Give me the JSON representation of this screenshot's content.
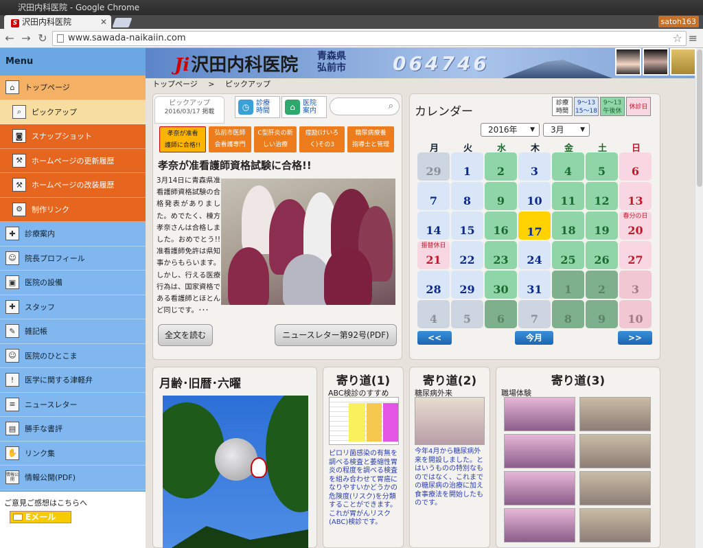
{
  "window": {
    "title": "沢田内科医院 - Google Chrome",
    "tab_title": "沢田内科医院",
    "user": "satoh163",
    "url": "www.sawada-naikaiin.com"
  },
  "banner": {
    "logo": "沢田内科医院",
    "pref1": "青森県",
    "pref2": "弘前市",
    "phone": "064746"
  },
  "sidebar": {
    "heading": "Menu",
    "items": [
      {
        "label": "トップページ",
        "icon": "house-icon"
      },
      {
        "label": "ピックアップ",
        "icon": "magnifier-icon"
      },
      {
        "label": "スナップショット",
        "icon": "camera-icon"
      },
      {
        "label": "ホームページの更新履歴",
        "icon": "hammer-icon"
      },
      {
        "label": "ホームページの改装履歴",
        "icon": "hammer-icon"
      },
      {
        "label": "制作リンク",
        "icon": "gear-icon"
      },
      {
        "label": "診療案内",
        "icon": "clinic-icon"
      },
      {
        "label": "院長プロフィール",
        "icon": "doctor-icon"
      },
      {
        "label": "医院の設備",
        "icon": "equipment-icon"
      },
      {
        "label": "スタッフ",
        "icon": "nurse-cap-icon"
      },
      {
        "label": "雑記帳",
        "icon": "notebook-icon"
      },
      {
        "label": "医院のひとこま",
        "icon": "photo-icon"
      },
      {
        "label": "医学に関する津軽弁",
        "icon": "exclamation-icon"
      },
      {
        "label": "ニュースレター",
        "icon": "newsletter-icon"
      },
      {
        "label": "勝手な書評",
        "icon": "book-icon"
      },
      {
        "label": "リンク集",
        "icon": "handshake-icon"
      },
      {
        "label": "情報公開(PDF)",
        "icon": "info-icon"
      }
    ],
    "feedback_label": "ご意見ご感想はこちらへ",
    "email_button": "Eメール",
    "info_icon_text": "情報公開"
  },
  "breadcrumb": {
    "home": "トップページ",
    "sep": ">",
    "current": "ピックアップ"
  },
  "pickup": {
    "tab_label": "ピックアップ",
    "tab_date": "2016/03/17 掲載",
    "quick1": [
      "診療",
      "時間"
    ],
    "quick2": [
      "医院",
      "案内"
    ],
    "tags": [
      [
        "孝奈が准看",
        "護師に合格!!"
      ],
      [
        "弘前市医師",
        "会看護専門"
      ],
      [
        "C型肝炎の新",
        "しい治療"
      ],
      [
        "痙励(けいろ",
        "く)その3"
      ],
      [
        "糖尿病療養",
        "指導士と管理"
      ]
    ],
    "headline": "孝奈が准看護師資格試験に合格!!",
    "body": "3月14日に青森県准看護師資格試験の合格発表がありました。めでたく、棟方孝奈さんは合格しました。おめでとう!!准看護師免許は県知事からもらいます。しかし、行える医療行為は、国家資格である看護師とほとんど同じです。･･･",
    "read_more": "全文を読む",
    "newsletter": "ニュースレター第92号(PDF)"
  },
  "calendar": {
    "title": "カレンダー",
    "legend": [
      [
        "診療",
        "時間"
      ],
      [
        "9～13",
        "15～18"
      ],
      [
        "9～13",
        "午後休"
      ],
      [
        "休診日",
        ""
      ]
    ],
    "year": "2016年",
    "month": "3月",
    "weekdays": [
      "月",
      "火",
      "水",
      "木",
      "金",
      "土",
      "日"
    ],
    "weeks": [
      [
        {
          "d": "29",
          "k": "out"
        },
        {
          "d": "1",
          "k": "n"
        },
        {
          "d": "2",
          "k": "g"
        },
        {
          "d": "3",
          "k": "n"
        },
        {
          "d": "4",
          "k": "g"
        },
        {
          "d": "5",
          "k": "g"
        },
        {
          "d": "6",
          "k": "h"
        }
      ],
      [
        {
          "d": "7",
          "k": "n"
        },
        {
          "d": "8",
          "k": "n"
        },
        {
          "d": "9",
          "k": "g"
        },
        {
          "d": "10",
          "k": "n"
        },
        {
          "d": "11",
          "k": "g"
        },
        {
          "d": "12",
          "k": "g"
        },
        {
          "d": "13",
          "k": "h"
        }
      ],
      [
        {
          "d": "14",
          "k": "n"
        },
        {
          "d": "15",
          "k": "n"
        },
        {
          "d": "16",
          "k": "g"
        },
        {
          "d": "17",
          "k": "today"
        },
        {
          "d": "18",
          "k": "g"
        },
        {
          "d": "19",
          "k": "g"
        },
        {
          "d": "20",
          "k": "h",
          "note": "春分の日"
        }
      ],
      [
        {
          "d": "21",
          "k": "h",
          "note": "振替休日"
        },
        {
          "d": "22",
          "k": "n"
        },
        {
          "d": "23",
          "k": "g"
        },
        {
          "d": "24",
          "k": "n"
        },
        {
          "d": "25",
          "k": "g"
        },
        {
          "d": "26",
          "k": "g"
        },
        {
          "d": "27",
          "k": "h"
        }
      ],
      [
        {
          "d": "28",
          "k": "n"
        },
        {
          "d": "29",
          "k": "n"
        },
        {
          "d": "30",
          "k": "g"
        },
        {
          "d": "31",
          "k": "n"
        },
        {
          "d": "1",
          "k": "og"
        },
        {
          "d": "2",
          "k": "og"
        },
        {
          "d": "3",
          "k": "oh"
        }
      ],
      [
        {
          "d": "4",
          "k": "out"
        },
        {
          "d": "5",
          "k": "out"
        },
        {
          "d": "6",
          "k": "og"
        },
        {
          "d": "7",
          "k": "out"
        },
        {
          "d": "8",
          "k": "og"
        },
        {
          "d": "9",
          "k": "og"
        },
        {
          "d": "10",
          "k": "oh"
        }
      ]
    ],
    "prev": "<<",
    "today": "今月",
    "next": ">>"
  },
  "moon": {
    "title": "月齢･旧暦･六曜"
  },
  "yorimichi1": {
    "title": "寄り道(1)",
    "sub": "ABC検診のすすめ",
    "text": "ピロリ菌感染の有無を調べる検査と萎縮性胃炎の程度を調べる検査を組み合わせて胃癌になりやすいかどうかの危険度(リスク)を分類することができます。これが胃がんリスク(ABC)検診です。"
  },
  "yorimichi2": {
    "title": "寄り道(2)",
    "sub": "糖尿病外来",
    "text": "今年4月から糖尿病外来を開設しました。とはいうものの特別なものではなく、これまでの糖尿病の治療に加え食事療法を開始したものです。"
  },
  "yorimichi3": {
    "title": "寄り道(3)",
    "sub": "職場体験"
  },
  "colors": {
    "sidebar_blue": "#6aa7e3",
    "sidebar_orange": "#e6661f",
    "cal_green": "#8fd5a8",
    "cal_blue": "#d8e6f7",
    "cal_pink": "#f9d7e2",
    "today_yellow": "#ffd200"
  }
}
